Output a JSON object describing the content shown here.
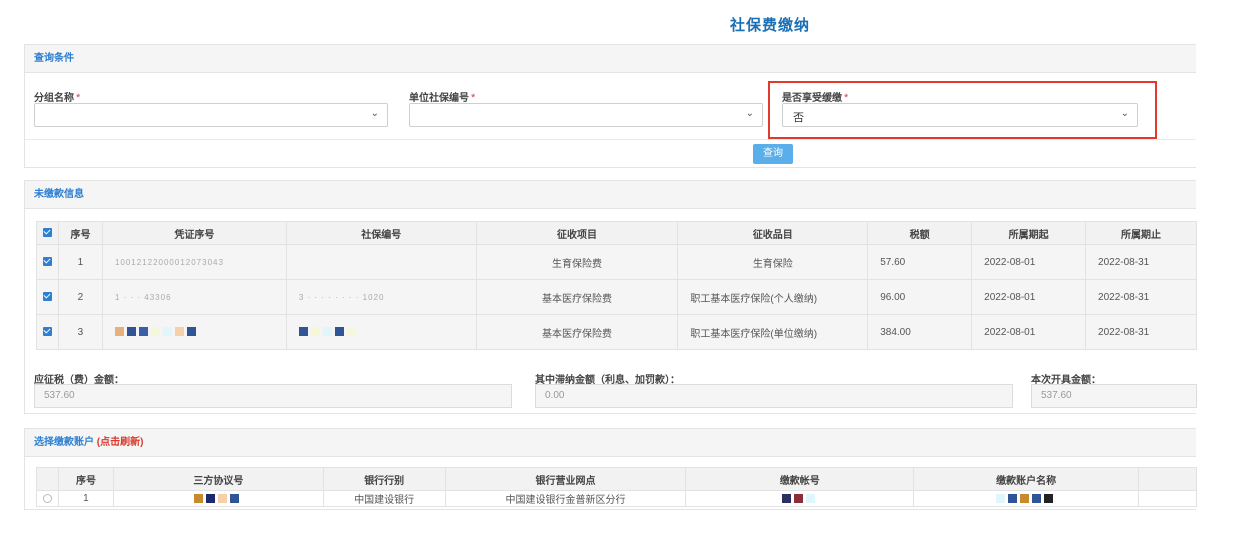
{
  "page": {
    "title": "社保费缴纳"
  },
  "query": {
    "header": "查询条件",
    "fields": [
      {
        "label": "分组名称",
        "required_mark": "*",
        "value": ""
      },
      {
        "label": "单位社保编号",
        "required_mark": "*",
        "value": ""
      },
      {
        "label": "是否享受缓缴",
        "required_mark": "*",
        "value": "否"
      }
    ],
    "button_label": "查询"
  },
  "unpaid": {
    "header": "未缴款信息",
    "columns": [
      "序号",
      "凭证序号",
      "社保编号",
      "征收项目",
      "征收品目",
      "税额",
      "所属期起",
      "所属期止"
    ],
    "rows": [
      {
        "checked": true,
        "no": "1",
        "voucher": "10012122000012073043",
        "social_no": "",
        "item": "生育保险费",
        "subitem": "生育保险",
        "amount": "57.60",
        "start": "2022-08-01",
        "end": "2022-08-31"
      },
      {
        "checked": true,
        "no": "2",
        "voucher": "1 · · · 43306",
        "social_no": "3 · · · · · · · · 1020",
        "item": "基本医疗保险费",
        "subitem": "职工基本医疗保险(个人缴纳)",
        "amount": "96.00",
        "start": "2022-08-01",
        "end": "2022-08-31"
      },
      {
        "checked": true,
        "no": "3",
        "voucher": "",
        "social_no": "",
        "item": "基本医疗保险费",
        "subitem": "职工基本医疗保险(单位缴纳)",
        "amount": "384.00",
        "start": "2022-08-01",
        "end": "2022-08-31"
      }
    ],
    "masked_colors": {
      "row3_voucher": [
        "#e8b07a",
        "#2f5597",
        "#3a5faa",
        "#f4f7d8",
        "#dff6fb",
        "#f5d0a8",
        "#2f5597"
      ],
      "row3_social": [
        "#2f5597",
        "#f6f7d6",
        "#dff6fb",
        "#2f5597",
        "#f4f7d8"
      ]
    },
    "summary": [
      {
        "label": "应征税（费）金额：",
        "value": "537.60"
      },
      {
        "label": "其中滞纳金额（利息、加罚款）：",
        "value": "0.00"
      },
      {
        "label": "本次开具金额：",
        "value": "537.60"
      }
    ]
  },
  "account": {
    "header": "选择缴款账户",
    "refresh_label": "(点击刷新)",
    "columns": [
      "序号",
      "三方协议号",
      "银行行别",
      "银行营业网点",
      "缴款帐号",
      "缴款账户名称"
    ],
    "rows": [
      {
        "no": "1",
        "bank": "中国建设银行",
        "branch": "中国建设银行金普新区分行"
      }
    ],
    "masked_colors": {
      "agreement": [
        "#c98a2f",
        "#1f2a6e",
        "#f5d0a8",
        "#2f5597"
      ],
      "account_no": [
        "#2b3060",
        "#8a2f3a",
        "#dff6fb"
      ],
      "account_name": [
        "#dff6fb",
        "#2f5597",
        "#c98a2f",
        "#2f5597",
        "#222222"
      ]
    }
  }
}
